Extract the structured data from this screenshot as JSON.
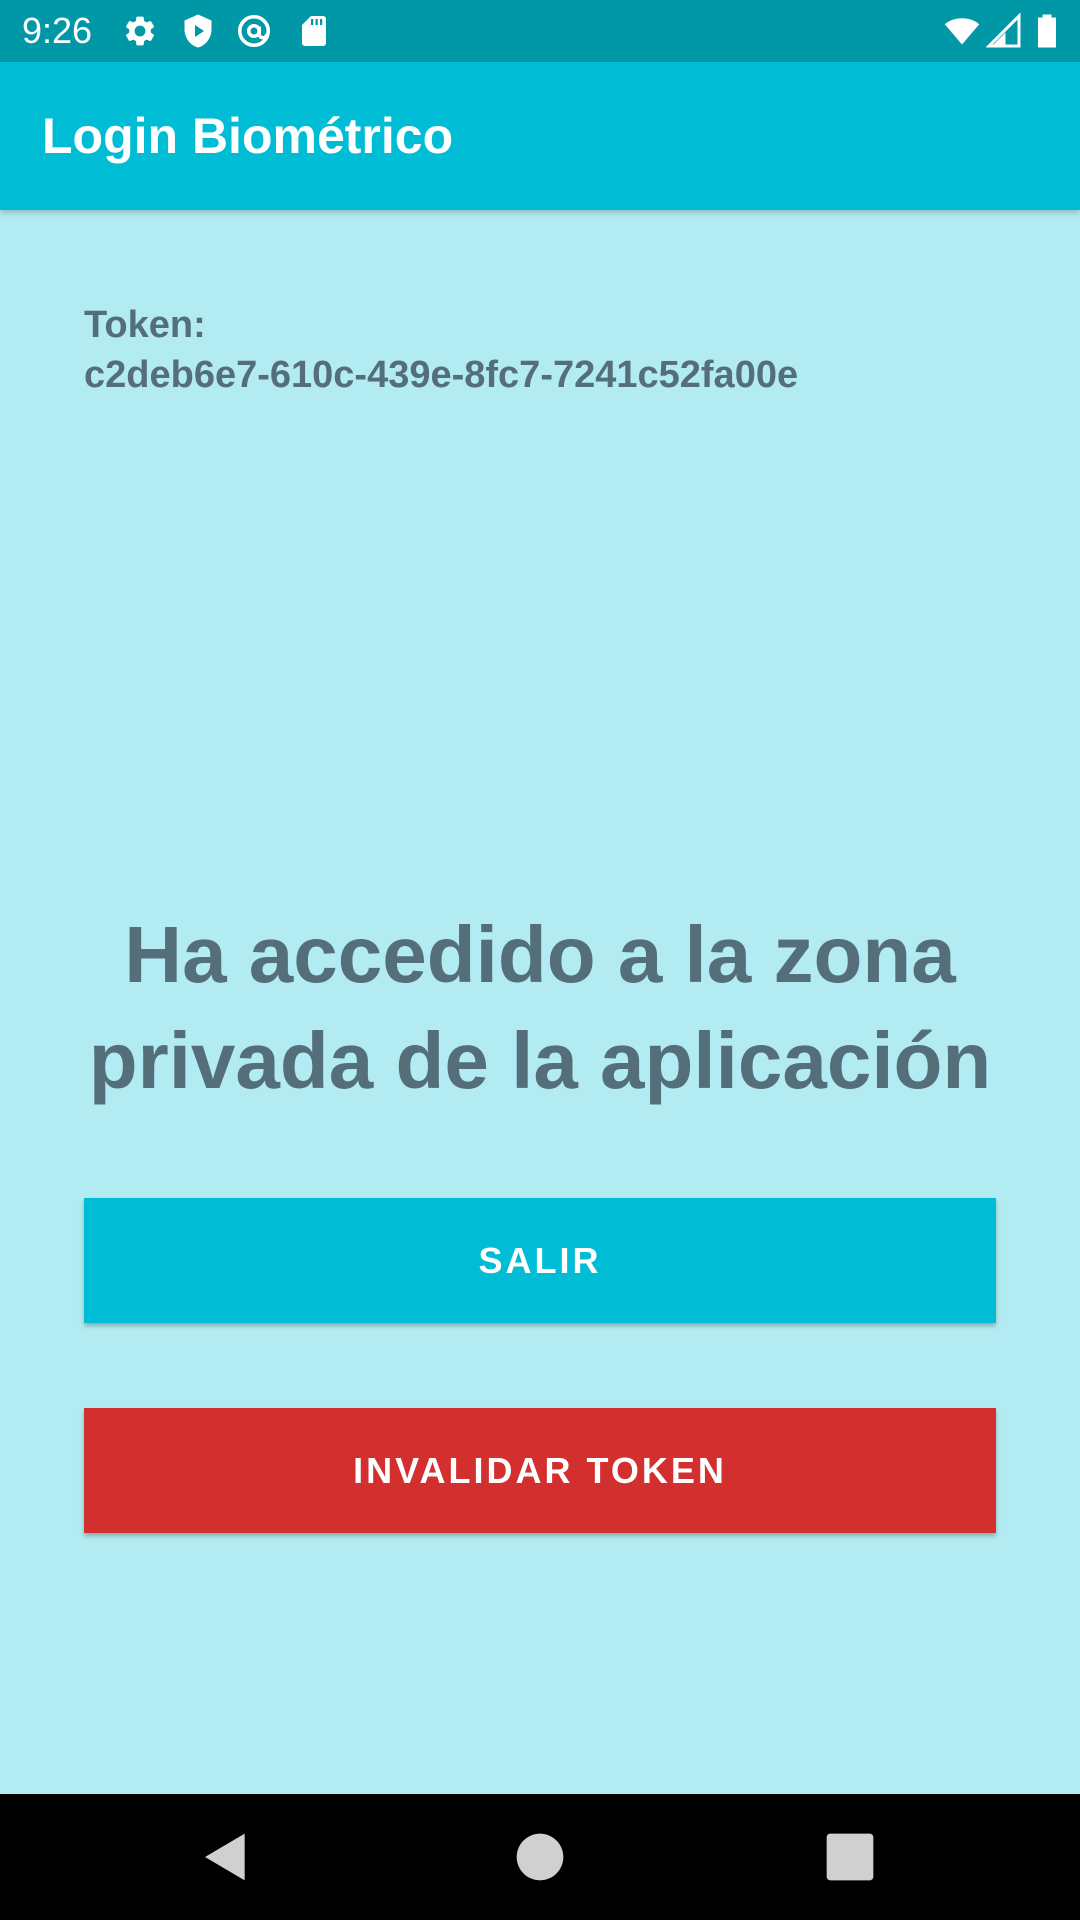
{
  "status_bar": {
    "time": "9:26",
    "left_icons": [
      "gear-icon",
      "shield-play-icon",
      "at-sign-icon",
      "sd-card-icon"
    ],
    "right_icons": [
      "wifi-icon",
      "cell-signal-icon",
      "battery-icon"
    ]
  },
  "app_bar": {
    "title": "Login Biométrico"
  },
  "main": {
    "token_label": "Token:",
    "token_value": "c2deb6e7-610c-439e-8fc7-7241c52fa00e",
    "headline": "Ha accedido a la zona privada de la aplicación",
    "exit_button_label": "SALIR",
    "invalidate_button_label": "INVALIDAR TOKEN"
  },
  "colors": {
    "status_bar": "#0097a7",
    "app_bar": "#00bcd4",
    "background": "#b2ebf2",
    "text": "#546e7a",
    "exit_button": "#00bcd4",
    "invalidate_button": "#d32f2f"
  },
  "nav_bar": {
    "icons": [
      "back-icon",
      "home-icon",
      "recents-icon"
    ]
  }
}
